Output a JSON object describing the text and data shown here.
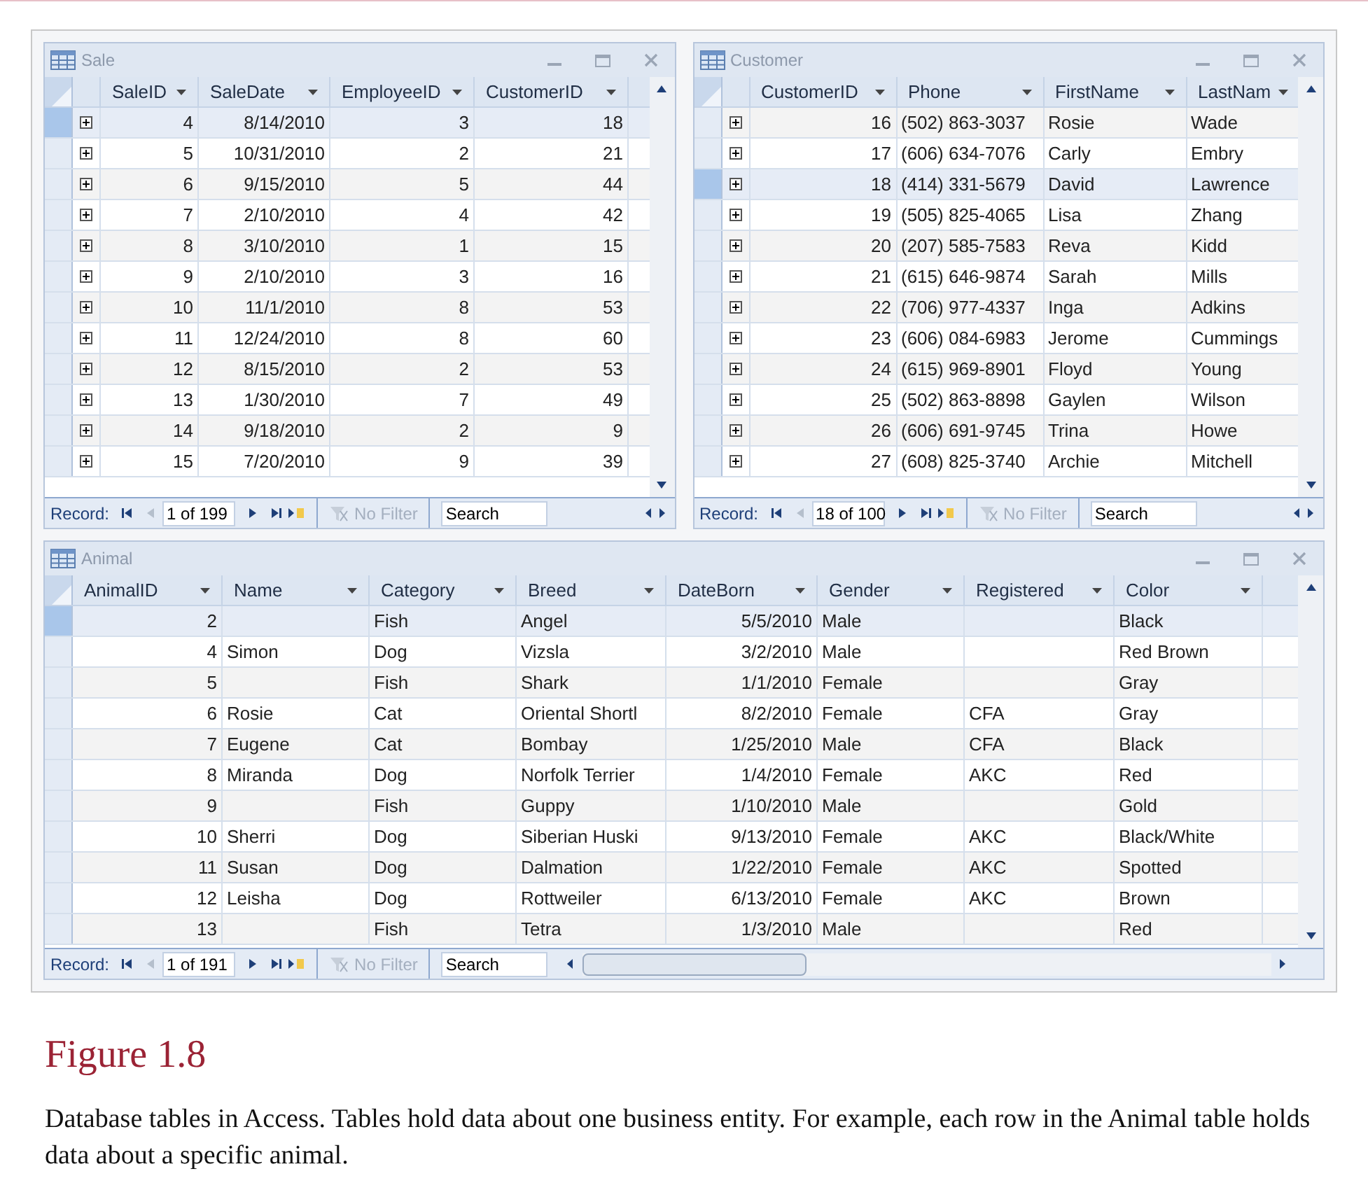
{
  "windows": [
    {
      "title": "Sale",
      "expandable": true,
      "columns": [
        {
          "label": "SaleID",
          "kind": "number"
        },
        {
          "label": "SaleDate",
          "kind": "number"
        },
        {
          "label": "EmployeeID",
          "kind": "number"
        },
        {
          "label": "CustomerID",
          "kind": "number"
        }
      ],
      "rows": [
        {
          "selected": true,
          "cells": [
            "4",
            "8/14/2010",
            "3",
            "18"
          ]
        },
        {
          "selected": false,
          "cells": [
            "5",
            "10/31/2010",
            "2",
            "21"
          ]
        },
        {
          "selected": false,
          "cells": [
            "6",
            "9/15/2010",
            "5",
            "44"
          ]
        },
        {
          "selected": false,
          "cells": [
            "7",
            "2/10/2010",
            "4",
            "42"
          ]
        },
        {
          "selected": false,
          "cells": [
            "8",
            "3/10/2010",
            "1",
            "15"
          ]
        },
        {
          "selected": false,
          "cells": [
            "9",
            "2/10/2010",
            "3",
            "16"
          ]
        },
        {
          "selected": false,
          "cells": [
            "10",
            "11/1/2010",
            "8",
            "53"
          ]
        },
        {
          "selected": false,
          "cells": [
            "11",
            "12/24/2010",
            "8",
            "60"
          ]
        },
        {
          "selected": false,
          "cells": [
            "12",
            "8/15/2010",
            "2",
            "53"
          ]
        },
        {
          "selected": false,
          "cells": [
            "13",
            "1/30/2010",
            "7",
            "49"
          ]
        },
        {
          "selected": false,
          "cells": [
            "14",
            "9/18/2010",
            "2",
            "9"
          ]
        },
        {
          "selected": false,
          "cells": [
            "15",
            "7/20/2010",
            "9",
            "39"
          ]
        }
      ],
      "record_label": "Record:",
      "record": "1 of 199",
      "filter": "No Filter",
      "search": {
        "placeholder": "Search"
      }
    },
    {
      "title": "Customer",
      "expandable": true,
      "columns": [
        {
          "label": "CustomerID",
          "kind": "number"
        },
        {
          "label": "Phone",
          "kind": "text"
        },
        {
          "label": "FirstName",
          "kind": "text"
        },
        {
          "label": "LastNam",
          "kind": "text"
        }
      ],
      "rows": [
        {
          "selected": false,
          "cells": [
            "16",
            "(502) 863-3037",
            "Rosie",
            "Wade"
          ]
        },
        {
          "selected": false,
          "cells": [
            "17",
            "(606) 634-7076",
            "Carly",
            "Embry"
          ]
        },
        {
          "selected": true,
          "cells": [
            "18",
            "(414) 331-5679",
            "David",
            "Lawrence"
          ]
        },
        {
          "selected": false,
          "cells": [
            "19",
            "(505) 825-4065",
            "Lisa",
            "Zhang"
          ]
        },
        {
          "selected": false,
          "cells": [
            "20",
            "(207) 585-7583",
            "Reva",
            "Kidd"
          ]
        },
        {
          "selected": false,
          "cells": [
            "21",
            "(615) 646-9874",
            "Sarah",
            "Mills"
          ]
        },
        {
          "selected": false,
          "cells": [
            "22",
            "(706) 977-4337",
            "Inga",
            "Adkins"
          ]
        },
        {
          "selected": false,
          "cells": [
            "23",
            "(606) 084-6983",
            "Jerome",
            "Cummings"
          ]
        },
        {
          "selected": false,
          "cells": [
            "24",
            "(615) 969-8901",
            "Floyd",
            "Young"
          ]
        },
        {
          "selected": false,
          "cells": [
            "25",
            "(502) 863-8898",
            "Gaylen",
            "Wilson"
          ]
        },
        {
          "selected": false,
          "cells": [
            "26",
            "(606) 691-9745",
            "Trina",
            "Howe"
          ]
        },
        {
          "selected": false,
          "cells": [
            "27",
            "(608) 825-3740",
            "Archie",
            "Mitchell"
          ]
        }
      ],
      "record_label": "Record:",
      "record": "18 of 100",
      "filter": "No Filter",
      "search": {
        "placeholder": "Search"
      }
    },
    {
      "title": "Animal",
      "expandable": false,
      "columns": [
        {
          "label": "AnimalID",
          "kind": "number"
        },
        {
          "label": "Name",
          "kind": "text"
        },
        {
          "label": "Category",
          "kind": "text"
        },
        {
          "label": "Breed",
          "kind": "text"
        },
        {
          "label": "DateBorn",
          "kind": "number"
        },
        {
          "label": "Gender",
          "kind": "text"
        },
        {
          "label": "Registered",
          "kind": "text"
        },
        {
          "label": "Color",
          "kind": "text"
        }
      ],
      "rows": [
        {
          "selected": true,
          "cells": [
            "2",
            "",
            "Fish",
            "Angel",
            "5/5/2010",
            "Male",
            "",
            "Black"
          ]
        },
        {
          "selected": false,
          "cells": [
            "4",
            "Simon",
            "Dog",
            "Vizsla",
            "3/2/2010",
            "Male",
            "",
            "Red Brown"
          ]
        },
        {
          "selected": false,
          "cells": [
            "5",
            "",
            "Fish",
            "Shark",
            "1/1/2010",
            "Female",
            "",
            "Gray"
          ]
        },
        {
          "selected": false,
          "cells": [
            "6",
            "Rosie",
            "Cat",
            "Oriental Shortl",
            "8/2/2010",
            "Female",
            "CFA",
            "Gray"
          ]
        },
        {
          "selected": false,
          "cells": [
            "7",
            "Eugene",
            "Cat",
            "Bombay",
            "1/25/2010",
            "Male",
            "CFA",
            "Black"
          ]
        },
        {
          "selected": false,
          "cells": [
            "8",
            "Miranda",
            "Dog",
            "Norfolk Terrier",
            "1/4/2010",
            "Female",
            "AKC",
            "Red"
          ]
        },
        {
          "selected": false,
          "cells": [
            "9",
            "",
            "Fish",
            "Guppy",
            "1/10/2010",
            "Male",
            "",
            "Gold"
          ]
        },
        {
          "selected": false,
          "cells": [
            "10",
            "Sherri",
            "Dog",
            "Siberian Huski",
            "9/13/2010",
            "Female",
            "AKC",
            "Black/White"
          ]
        },
        {
          "selected": false,
          "cells": [
            "11",
            "Susan",
            "Dog",
            "Dalmation",
            "1/22/2010",
            "Female",
            "AKC",
            "Spotted"
          ]
        },
        {
          "selected": false,
          "cells": [
            "12",
            "Leisha",
            "Dog",
            "Rottweiler",
            "6/13/2010",
            "Female",
            "AKC",
            "Brown"
          ]
        },
        {
          "selected": false,
          "cells": [
            "13",
            "",
            "Fish",
            "Tetra",
            "1/3/2010",
            "Male",
            "",
            "Red"
          ]
        }
      ],
      "record_label": "Record:",
      "record": "1 of 191",
      "filter": "No Filter",
      "search": {
        "placeholder": "Search"
      }
    }
  ],
  "caption": {
    "title": "Figure 1.8",
    "text": "Database tables in Access. Tables hold data about one business entity. For example, each row in the Animal table holds data about a specific animal."
  }
}
